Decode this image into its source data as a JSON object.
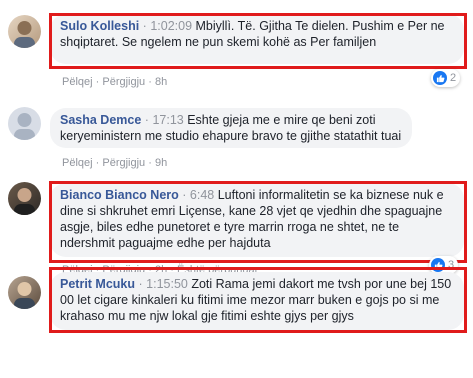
{
  "comments": [
    {
      "name": "Sulo Kolleshi",
      "time": "1:02:09",
      "text": "Mbiyllì. Të. Gjitha Te dielen. Pushim e Per ne shqiptaret. Se ngelem ne pun skemi kohë as Per familjen",
      "reactions": "2",
      "actions": [
        "Pëlqej",
        "Përgjigju",
        "8h"
      ]
    },
    {
      "name": "Sasha Demce",
      "time": "17:13",
      "text": "Eshte gjeja me e mire qe beni zoti keryeministern me studio ehapure bravo te gjithe statathit tuai",
      "actions": [
        "Pëlqej",
        "Përgjigju",
        "9h"
      ]
    },
    {
      "name": "Bianco Bianco Nero",
      "time": "6:48",
      "text": "Luftoni informalitetin se ka biznese nuk e dine si shkruhet emri Liçense, kane 28 vjet qe vjedhin dhe spaguajne asgje, biles edhe punetoret e tyre marrin rroga ne shtet, ne te ndershmit paguajme edhe per hajduta",
      "reactions": "3",
      "actions": [
        "Pëlqej",
        "Përgjigju",
        "2h",
        "Është përpunuar"
      ]
    },
    {
      "name": "Petrit Mcuku",
      "time": "1:15:50",
      "text": "Zoti Rama jemi dakort me tvsh por une bej 150 00 let cigare kinkaleri ku fitimi ime mezor marr buken e gojs po si me krahaso mu me njw lokal gje fitimi eshte gjys per gjys",
      "actions": []
    }
  ],
  "colors": {
    "highlight": "#e01b1b",
    "name": "#385898",
    "bubble": "#f2f3f5",
    "like": "#1877f2"
  }
}
